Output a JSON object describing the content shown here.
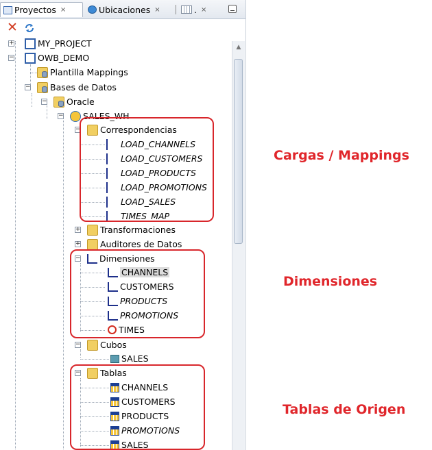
{
  "tabs": [
    {
      "label": "Proyectos",
      "close": "×"
    },
    {
      "label": "Ubicaciones",
      "close": "×"
    },
    {
      "label": ".",
      "close": "×"
    }
  ],
  "tree": {
    "partial_top": "MY_PROJECT",
    "project": "OWB_DEMO",
    "plantilla": "Plantilla Mappings",
    "bases": "Bases de Datos",
    "oracle": "Oracle",
    "module": "SALES_WH",
    "correspondencias": "Correspondencias",
    "mappings": [
      "LOAD_CHANNELS",
      "LOAD_CUSTOMERS",
      "LOAD_PRODUCTS",
      "LOAD_PROMOTIONS",
      "LOAD_SALES",
      "TIMES_MAP"
    ],
    "transformaciones": "Transformaciones",
    "auditores": "Auditores de Datos",
    "dimensiones": "Dimensiones",
    "dimensions": [
      "CHANNELS",
      "CUSTOMERS",
      "PRODUCTS",
      "PROMOTIONS",
      "TIMES"
    ],
    "cubos": "Cubos",
    "cubes": [
      "SALES"
    ],
    "tablas": "Tablas",
    "tables": [
      "CHANNELS",
      "CUSTOMERS",
      "PRODUCTS",
      "PROMOTIONS",
      "SALES"
    ]
  },
  "annotations": {
    "mappings": "Cargas / Mappings",
    "dimensions": "Dimensiones",
    "tables": "Tablas de Origen"
  },
  "colors": {
    "annotation": "#e0262b",
    "selection": "#dcdcdc"
  }
}
